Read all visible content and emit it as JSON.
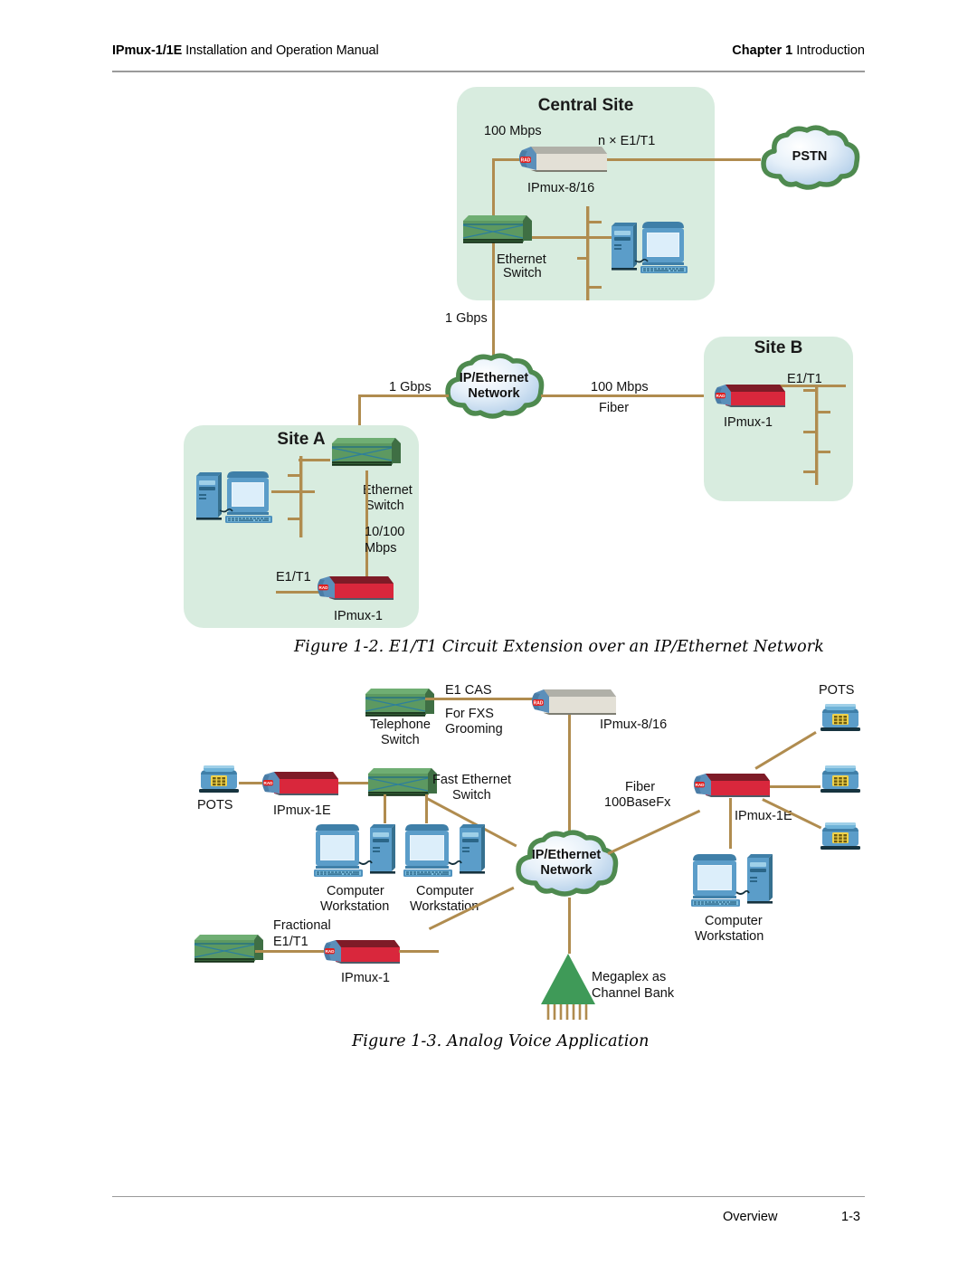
{
  "header": {
    "left_bold": "IPmux-1/1E",
    "left_rest": " Installation and Operation Manual",
    "right_bold": "Chapter 1",
    "right_rest": "  Introduction"
  },
  "footer": {
    "section": "Overview",
    "page_number": "1-3"
  },
  "figure1": {
    "caption": "Figure 1-2.  E1/T1 Circuit Extension over an IP/Ethernet Network",
    "central_site": {
      "title": "Central Site",
      "link_100mbps": "100 Mbps",
      "link_nxe1t1": "n × E1/T1",
      "ipmux_label": "IPmux-8/16",
      "switch_label_line1": "Ethernet",
      "switch_label_line2": "Switch"
    },
    "pstn": {
      "label": "PSTN"
    },
    "network_cloud": {
      "line1": "IP/Ethernet",
      "line2": "Network"
    },
    "links": {
      "gbps_vertical": "1 Gbps",
      "gbps_left": "1 Gbps",
      "mbps_right": "100 Mbps",
      "fiber_right": "Fiber"
    },
    "site_b": {
      "title": "Site B",
      "e1t1": "E1/T1",
      "device_label": "IPmux-1"
    },
    "site_a": {
      "title": "Site A",
      "switch_label_line1": "Ethernet",
      "switch_label_line2": "Switch",
      "speed_line1": "10/100",
      "speed_line2": "Mbps",
      "e1t1": "E1/T1",
      "device_label": "IPmux-1"
    }
  },
  "figure2": {
    "caption": "Figure 1-3.  Analog Voice Application",
    "telephone_switch": {
      "label_line1": "Telephone",
      "label_line2": "Switch"
    },
    "e1_cas": "E1 CAS",
    "for_fxs_line1": "For FXS",
    "for_fxs_line2": "Grooming",
    "ipmux_816_label": "IPmux-8/16",
    "pots_left": "POTS",
    "ipmux_1e_left": "IPmux-1E",
    "fast_ethernet_line1": "Fast Ethernet",
    "fast_ethernet_line2": "Switch",
    "workstation1_line1": "Computer",
    "workstation1_line2": "Workstation",
    "workstation2_line1": "Computer",
    "workstation2_line2": "Workstation",
    "network_cloud": {
      "line1": "IP/Ethernet",
      "line2": "Network"
    },
    "fiber_line1": "Fiber",
    "fiber_line2": "100BaseFx",
    "ipmux_1e_right": "IPmux-1E",
    "pots_right": "POTS",
    "workstation3_line1": "Computer",
    "workstation3_line2": "Workstation",
    "fractional_line1": "Fractional",
    "fractional_line2": "E1/T1",
    "ipmux_1_bottom": "IPmux-1",
    "megaplex_line1": "Megaplex as",
    "megaplex_line2": "Channel Bank"
  },
  "colors": {
    "panel_green": "#d8ecdf",
    "wire": "#b08c4f",
    "switch_green": "#4f8a53",
    "device_red": "#d9273c",
    "device_blue": "#5b8fba",
    "cloud_outline": "#4e8a4f",
    "rad_red": "#e02020"
  }
}
